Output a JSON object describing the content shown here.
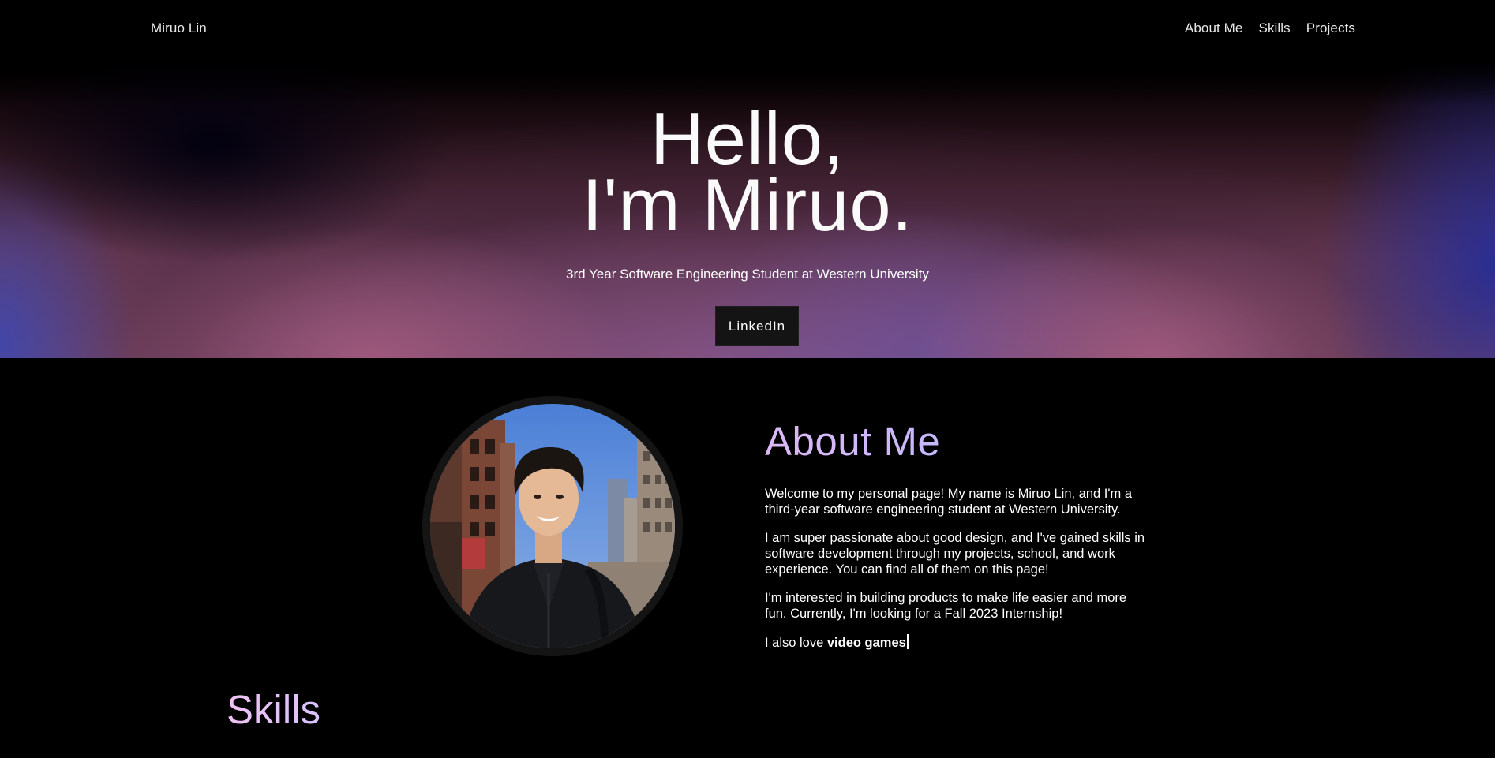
{
  "nav": {
    "brand": "Miruo Lin",
    "links": [
      "About Me",
      "Skills",
      "Projects"
    ]
  },
  "hero": {
    "title_line1": "Hello,",
    "title_line2": "I'm Miruo.",
    "subtitle": "3rd Year Software Engineering Student at Western University",
    "linkedin_label": "LinkedIn"
  },
  "about": {
    "title": "About Me",
    "paragraphs": [
      "Welcome to my personal page! My name is Miruo Lin, and I'm a third-year software engineering student at Western University.",
      "I am super passionate about good design, and I've gained skills in software development through my projects, school, and work experience. You can find all of them on this page!",
      "I'm interested in building products to make life easier and more fun. Currently, I'm looking for a Fall 2023 Internship!"
    ],
    "love_prefix": "I also love ",
    "love_item": "video games"
  },
  "skills": {
    "title": "Skills"
  },
  "colors": {
    "background": "#000000",
    "about_title_gradient": [
      "#dcb8f2",
      "#c6b7ff"
    ],
    "skills_title_gradient": [
      "#f0c0f2",
      "#d8c2ff"
    ],
    "button_bg": "#141414"
  },
  "icons": {
    "profile_photo": "profile-photo"
  }
}
